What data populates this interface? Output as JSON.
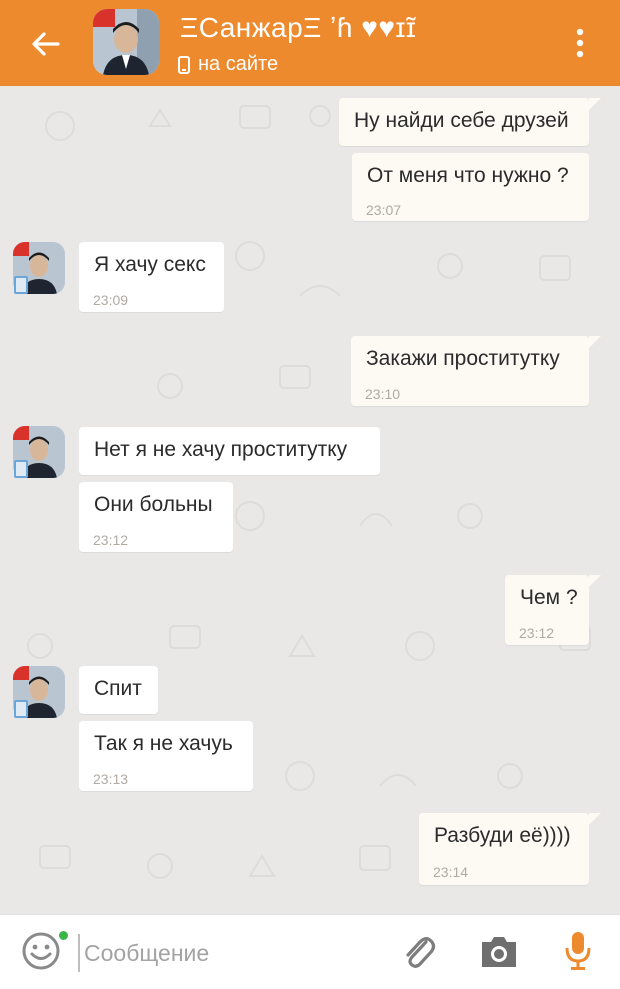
{
  "header": {
    "title": "ΞСанжарΞ  ʼɦ ♥♥ɪɪ̃",
    "status": "на сайте",
    "back_icon": "arrow-left-icon",
    "menu_icon": "more-vert-icon",
    "accent": "#ee8a2e"
  },
  "messages": [
    {
      "dir": "out",
      "text": "Ну найди себе друзей",
      "time": ""
    },
    {
      "dir": "out",
      "text": "От меня что нужно ?",
      "time": "23:07"
    },
    {
      "dir": "in",
      "text": "Я хачу секс",
      "time": "23:09"
    },
    {
      "dir": "out",
      "text": "Закажи проститутку",
      "time": "23:10"
    },
    {
      "dir": "in",
      "text": "Нет я не хачу проститутку",
      "time": ""
    },
    {
      "dir": "in",
      "text": "Они больны",
      "time": "23:12"
    },
    {
      "dir": "out",
      "text": "Чем ?",
      "time": "23:12"
    },
    {
      "dir": "in",
      "text": "Спит",
      "time": ""
    },
    {
      "dir": "in",
      "text": "Так я не хачуь",
      "time": "23:13"
    },
    {
      "dir": "out",
      "text": "Разбуди её))))",
      "time": "23:14"
    }
  ],
  "input": {
    "placeholder": "Сообщение",
    "value": ""
  },
  "icons": {
    "emoji": "smile-icon",
    "attach": "paperclip-icon",
    "camera": "camera-icon",
    "mic": "microphone-icon"
  },
  "colors": {
    "online": "#39b54a",
    "mic": "#ee8a2e"
  }
}
